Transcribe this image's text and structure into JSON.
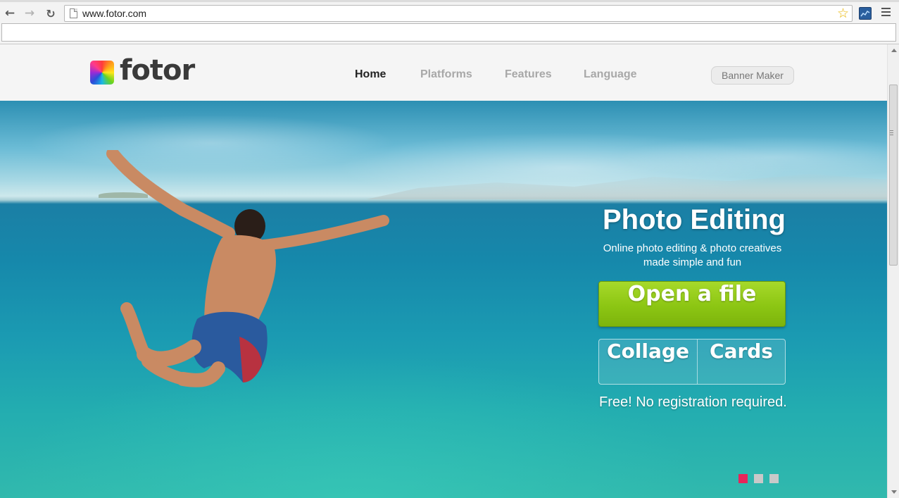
{
  "browser": {
    "url": "www.fotor.com",
    "icons": [
      "back-icon",
      "forward-icon",
      "reload-icon",
      "page-icon",
      "star-icon",
      "extension-icon",
      "menu-icon"
    ]
  },
  "header": {
    "logo_text": "fotor",
    "nav": [
      {
        "label": "Home",
        "active": true
      },
      {
        "label": "Platforms",
        "active": false
      },
      {
        "label": "Features",
        "active": false
      },
      {
        "label": "Language",
        "active": false
      }
    ],
    "banner_button": "Banner Maker"
  },
  "hero": {
    "title": "Photo Editing",
    "subtitle_line1": "Online photo editing & photo creatives",
    "subtitle_line2": "made simple and fun",
    "open_button": "Open a file",
    "collage_button": "Collage",
    "cards_button": "Cards",
    "note": "Free! No registration required.",
    "carousel": {
      "count": 3,
      "active_index": 0,
      "active_color": "#e8245a",
      "inactive_color": "#c9c9c9"
    }
  },
  "colors": {
    "accent_green": "#8cc613",
    "nav_active": "#222222",
    "nav_inactive": "#a8a8a8"
  }
}
